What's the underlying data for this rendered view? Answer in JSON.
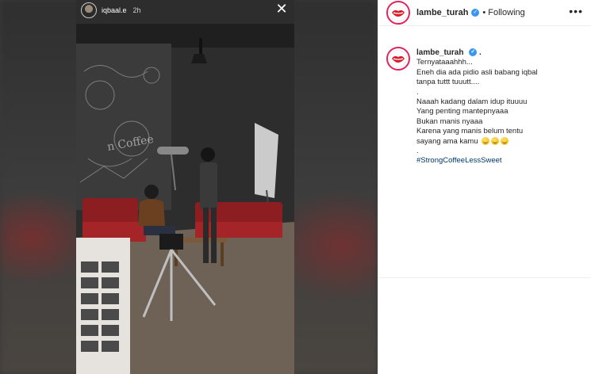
{
  "story": {
    "username": "iqbaal.e",
    "time": "2h",
    "close_icon": "close-icon"
  },
  "post": {
    "username": "lambe_turah",
    "separator": "•",
    "follow_status": "Following",
    "more_icon": "more-horizontal-icon"
  },
  "caption": {
    "username": "lambe_turah",
    "suffix": ".",
    "lines": [
      "Ternyataaahhh...",
      "Eneh dia ada pidio asli babang iqbal",
      "tanpa tuttt tuuutt....",
      ".",
      "Naaah kadang dalam idup ituuuu",
      "Yang penting mantepnyaaa",
      "Bukan manis nyaaa",
      "Karena yang manis belum tentu"
    ],
    "emoji_line": "sayang ama kamu",
    "after_emoji": ".",
    "hashtag": "#StrongCoffeeLessSweet"
  },
  "colors": {
    "verified": "#3897f0",
    "hashtag": "#00376b",
    "story_ring": "#e0245e"
  }
}
